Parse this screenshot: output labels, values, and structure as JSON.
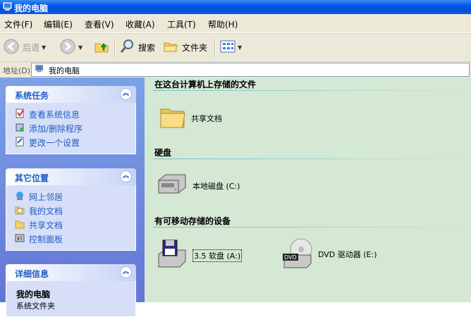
{
  "window": {
    "title": "我的电脑",
    "icon": "my-computer-icon"
  },
  "menu": [
    "文件(F)",
    "编辑(E)",
    "查看(V)",
    "收藏(A)",
    "工具(T)",
    "帮助(H)"
  ],
  "toolbar": {
    "back_label": "后退",
    "search_label": "搜索",
    "folders_label": "文件夹"
  },
  "address": {
    "label": "地址(D)",
    "value": "我的电脑"
  },
  "left": {
    "system_tasks": {
      "title": "系统任务",
      "items": [
        "查看系统信息",
        "添加/删除程序",
        "更改一个设置"
      ]
    },
    "other_places": {
      "title": "其它位置",
      "items": [
        "网上邻居",
        "我的文档",
        "共享文档",
        "控制面板"
      ]
    },
    "details": {
      "title": "详细信息",
      "name": "我的电脑",
      "sub": "系统文件夹"
    }
  },
  "main": {
    "groups": [
      {
        "title": "在这台计算机上存储的文件",
        "items": [
          "共享文档"
        ]
      },
      {
        "title": "硬盘",
        "items": [
          "本地磁盘 (C:)"
        ]
      },
      {
        "title": "有可移动存储的设备",
        "items": [
          "3.5 软盘 (A:)",
          "DVD 驱动器 (E:)"
        ]
      }
    ]
  },
  "colors": {
    "accent": "#215dc6",
    "titlebar": "#0058e6",
    "panel": "#d6dff7",
    "main_bg": "#d4e8d3"
  }
}
